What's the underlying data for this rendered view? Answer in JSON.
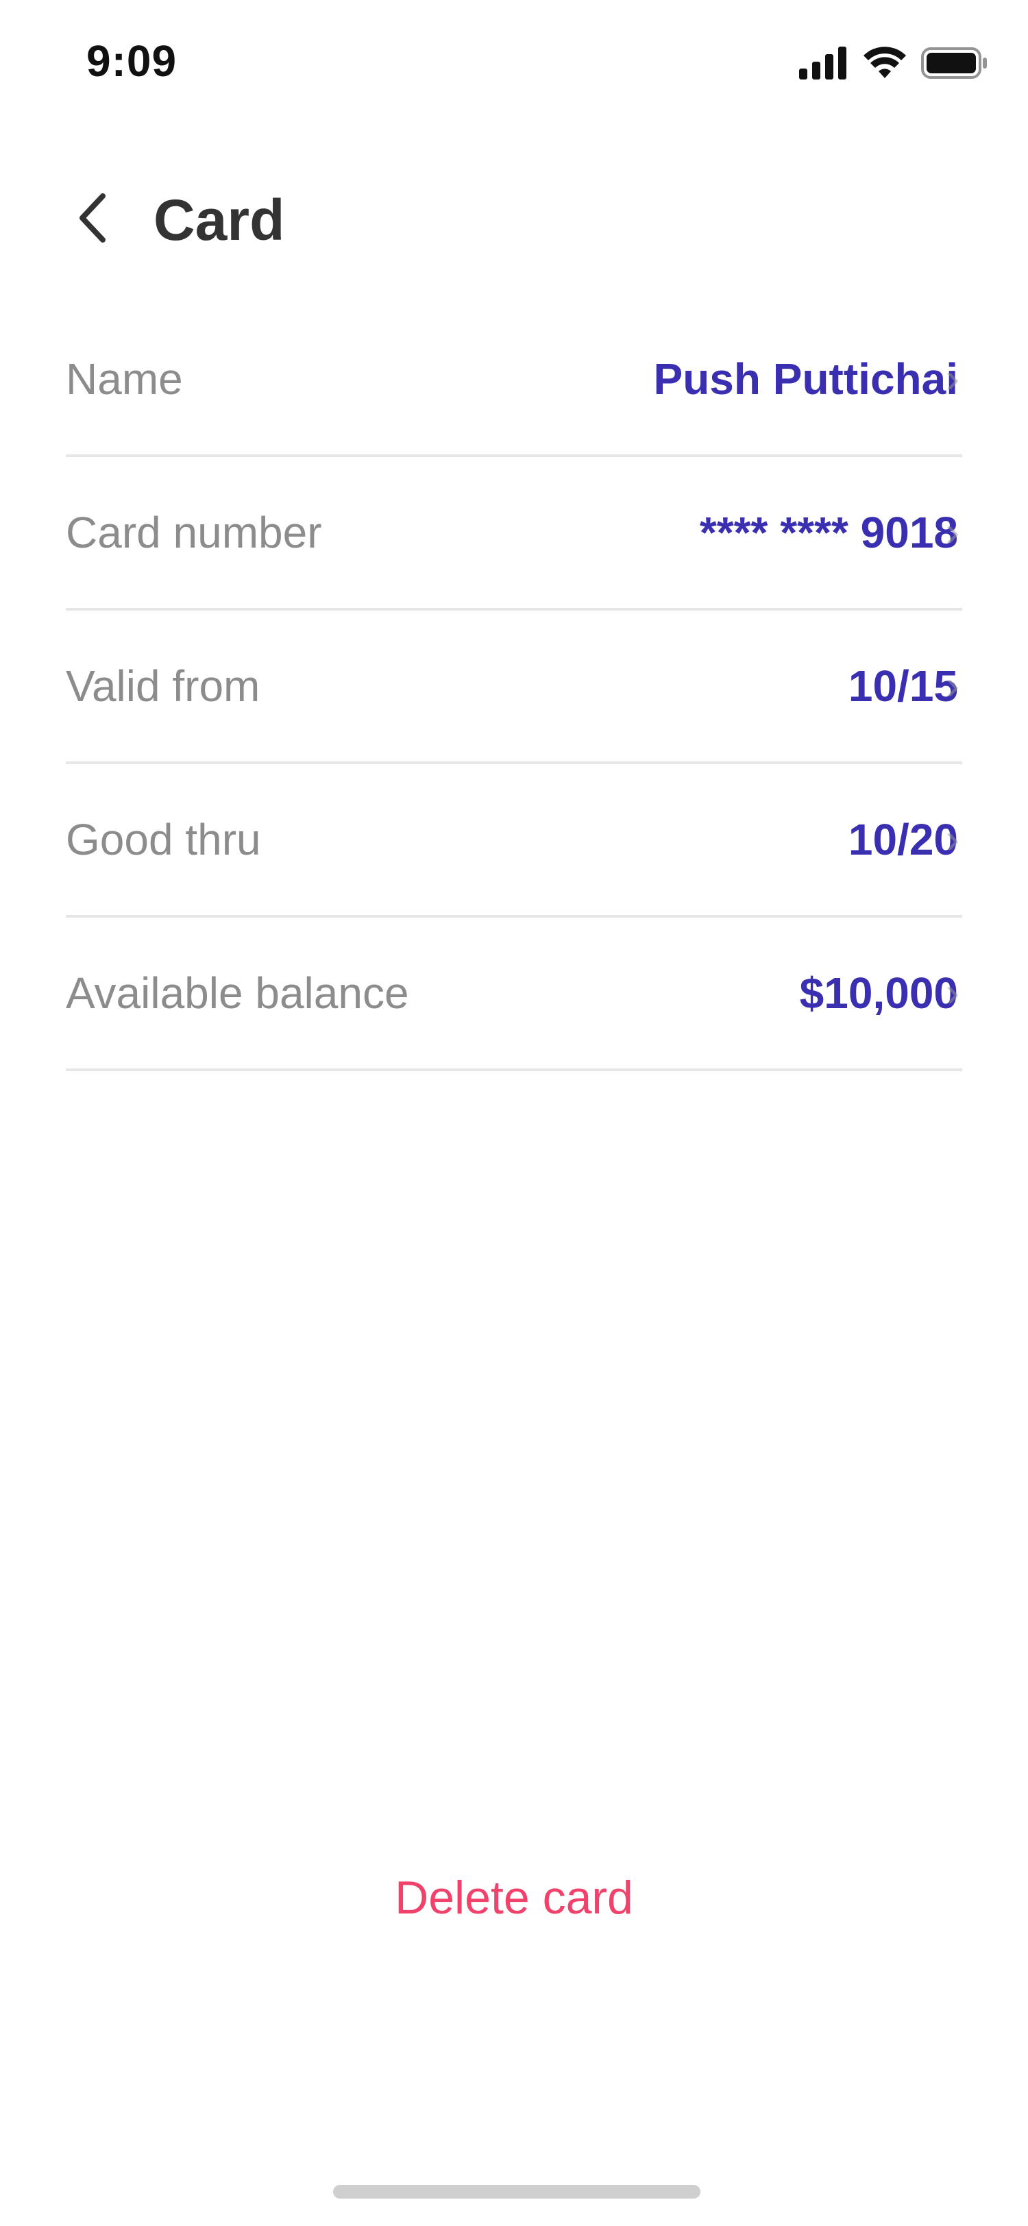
{
  "status_bar": {
    "time": "9:09",
    "icons": [
      "signal-icon",
      "wifi-icon",
      "battery-icon"
    ]
  },
  "header": {
    "back_icon": "chevron-left-icon",
    "title": "Card"
  },
  "rows": [
    {
      "label": "Name",
      "value": "Push Puttichai"
    },
    {
      "label": "Card number",
      "value": "**** **** 9018"
    },
    {
      "label": "Valid from",
      "value": "10/15"
    },
    {
      "label": "Good thru",
      "value": "10/20"
    },
    {
      "label": "Available balance",
      "value": "$10,000"
    }
  ],
  "actions": {
    "delete_label": "Delete card"
  },
  "colors": {
    "accent": "#3a2fb0",
    "label": "#8c8c8c",
    "danger": "#f0426a",
    "divider": "#e6e6e6",
    "title": "#333333"
  }
}
